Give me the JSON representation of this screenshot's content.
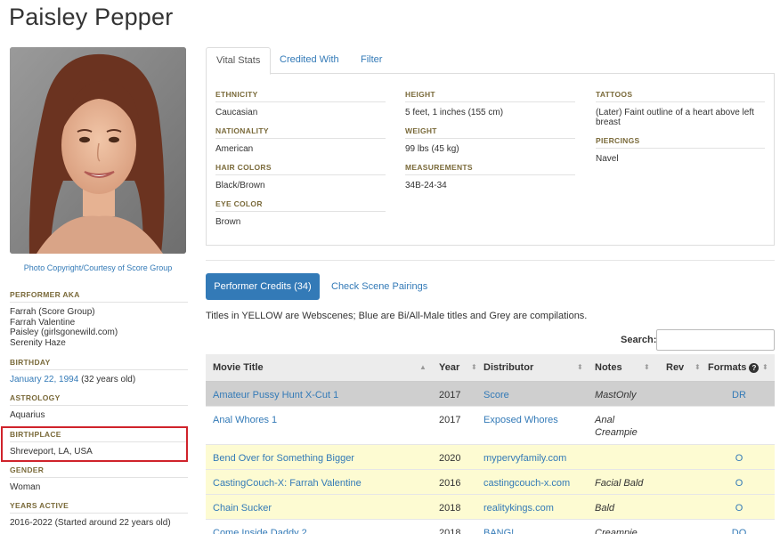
{
  "performer": {
    "name": "Paisley Pepper",
    "photo_credit": "Photo Copyright/Courtesy of Score Group"
  },
  "left_panel": {
    "aka_label": "PERFORMER AKA",
    "aka": [
      "Farrah (Score Group)",
      "Farrah Valentine",
      "Paisley (girlsgonewild.com)",
      "Serenity Haze"
    ],
    "birthday_label": "BIRTHDAY",
    "birthday_link": "January 22, 1994",
    "birthday_age": "(32 years old)",
    "astrology_label": "ASTROLOGY",
    "astrology": "Aquarius",
    "birthplace_label": "BIRTHPLACE",
    "birthplace": "Shreveport, LA, USA",
    "gender_label": "GENDER",
    "gender": "Woman",
    "years_active_label": "YEARS ACTIVE",
    "years_active": "2016-2022 (Started around 22 years old)"
  },
  "tabs": [
    {
      "label": "Vital Stats",
      "active": true
    },
    {
      "label": "Credited With",
      "active": false
    },
    {
      "label": "Filter",
      "active": false
    }
  ],
  "vital_stats": {
    "ethnicity_label": "ETHNICITY",
    "ethnicity": "Caucasian",
    "nationality_label": "NATIONALITY",
    "nationality": "American",
    "hair_label": "HAIR COLORS",
    "hair": "Black/Brown",
    "eye_label": "EYE COLOR",
    "eye": "Brown",
    "height_label": "HEIGHT",
    "height": "5 feet, 1 inches (155 cm)",
    "weight_label": "WEIGHT",
    "weight": "99 lbs (45 kg)",
    "measurements_label": "MEASUREMENTS",
    "measurements": "34B-24-34",
    "tattoos_label": "TATTOOS",
    "tattoos": "(Later) Faint outline of a heart above left breast",
    "piercings_label": "PIERCINGS",
    "piercings": "Navel"
  },
  "credits": {
    "performer_credits_button": "Performer Credits (34)",
    "check_pairings_link": "Check Scene Pairings",
    "legend_note": "Titles in YELLOW are Webscenes; Blue are Bi/All-Male titles and Grey are compilations.",
    "search_label": "Search:",
    "search_value": "",
    "columns": {
      "title": "Movie Title",
      "year": "Year",
      "distributor": "Distributor",
      "notes": "Notes",
      "rev": "Rev",
      "formats": "Formats"
    },
    "rows": [
      {
        "title": "Amateur Pussy Hunt X-Cut 1",
        "year": "2017",
        "distributor": "Score",
        "notes1": "MastOnly",
        "notes2": "",
        "formats": "DR",
        "style": "grey"
      },
      {
        "title": "Anal Whores 1",
        "year": "2017",
        "distributor": "Exposed Whores",
        "notes1": "Anal",
        "notes2": "Creampie",
        "formats": "",
        "style": "white"
      },
      {
        "title": "Bend Over for Something Bigger",
        "year": "2020",
        "distributor": "mypervyfamily.com",
        "notes1": "",
        "notes2": "",
        "formats": "O",
        "style": "yellow"
      },
      {
        "title": "CastingCouch-X: Farrah Valentine",
        "year": "2016",
        "distributor": "castingcouch-x.com",
        "notes1": "Facial Bald",
        "notes2": "",
        "formats": "O",
        "style": "yellow"
      },
      {
        "title": "Chain Sucker",
        "year": "2018",
        "distributor": "realitykings.com",
        "notes1": "Bald",
        "notes2": "",
        "formats": "O",
        "style": "yellow"
      },
      {
        "title": "Come Inside Daddy 2",
        "year": "2018",
        "distributor": "BANG!",
        "notes1": "Creampie",
        "notes2": "",
        "formats": "DO",
        "style": "white"
      }
    ]
  },
  "colors": {
    "link": "#337ab7",
    "highlight_border": "#d0232b",
    "grey_row": "#cfcfcf",
    "yellow_row": "#fdfbd2"
  }
}
